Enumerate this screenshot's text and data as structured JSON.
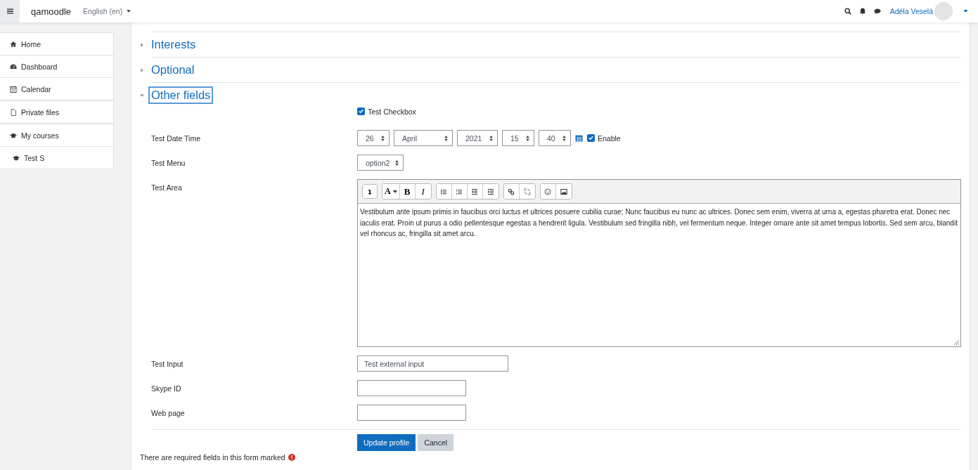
{
  "navbar": {
    "site_name": "qamoodle",
    "language": "English (en)",
    "user_name": "Adéla Veselá"
  },
  "sidebar": {
    "items": [
      {
        "label": "Home",
        "selected": false
      },
      {
        "label": "Dashboard",
        "selected": false
      },
      {
        "label": "Calendar",
        "selected": false
      },
      {
        "label": "Private files",
        "selected": false
      },
      {
        "label": "My courses",
        "selected": false,
        "children": [
          {
            "label": "Test S",
            "selected": false
          }
        ]
      }
    ]
  },
  "sections": [
    {
      "title": "Interests",
      "expanded": false,
      "focused": false
    },
    {
      "title": "Optional",
      "expanded": false,
      "focused": false
    },
    {
      "title": "Other fields",
      "expanded": true,
      "focused": true
    }
  ],
  "form": {
    "checkbox": {
      "label": "Test Checkbox",
      "checked": true
    },
    "rows": [
      {
        "kind": "datetime",
        "label": "Test Date Time",
        "selects": [
          "26",
          "April",
          "2021",
          "15",
          "40"
        ],
        "enable": {
          "label": "Enable",
          "checked": true
        }
      },
      {
        "kind": "select",
        "label": "Test Menu",
        "value": "option2"
      },
      {
        "kind": "editor",
        "label": "Test Area",
        "toolbar": [
          [
            {
              "kind": "collapse"
            }
          ],
          [
            {
              "kind": "font",
              "label": "A"
            },
            {
              "kind": "bold",
              "label": "B"
            },
            {
              "kind": "italic",
              "label": "I"
            }
          ],
          [
            {
              "kind": "bullets"
            },
            {
              "kind": "numbers"
            },
            {
              "kind": "outdent"
            },
            {
              "kind": "indent"
            }
          ],
          [
            {
              "kind": "link"
            },
            {
              "kind": "unlink"
            }
          ],
          [
            {
              "kind": "emoji"
            },
            {
              "kind": "image"
            }
          ]
        ],
        "text": "Vestibulum ante ipsum primis in faucibus orci luctus et ultrices posuere cubilia curae; Nunc faucibus eu nunc ac ultrices. Donec sem enim, viverra at urna a, egestas pharetra erat. Donec nec iaculis erat. Proin ut purus a odio pellentesque egestas a hendrerit ligula. Vestibulum sed fringilla nibh, vel fermentum neque. Integer ornare ante sit amet tempus lobortis. Sed sem arcu, blandit vel rhoncus ac, fringilla sit amet arcu."
      },
      {
        "kind": "input",
        "label": "Test Input",
        "value": "Test external input"
      },
      {
        "kind": "input",
        "label": "Skype ID"
      },
      {
        "kind": "input",
        "label": "Web page"
      }
    ]
  },
  "buttons": [
    {
      "kind": "primary",
      "label": "Update profile"
    },
    {
      "kind": "secondary",
      "label": "Cancel"
    }
  ],
  "required_note": "There are required fields in this form marked"
}
